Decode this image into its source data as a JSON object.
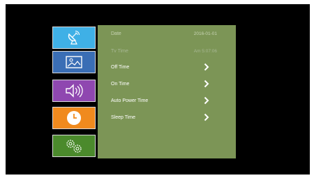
{
  "sidebar": {
    "tabs": [
      {
        "icon": "satellite-dish-icon",
        "color": "#3fb0e6"
      },
      {
        "icon": "picture-icon",
        "color": "#3a6eb5"
      },
      {
        "icon": "speaker-icon",
        "color": "#8f47b0"
      },
      {
        "icon": "clock-icon",
        "color": "#f08a1e",
        "selected": true
      },
      {
        "icon": "gears-icon",
        "color": "#4b8a2c"
      }
    ]
  },
  "menu": {
    "date_label": "Date",
    "date_value": "2016-01-01",
    "tvtime_label": "Tv Time",
    "tvtime_value": "Am 5:07:06",
    "items": [
      {
        "label": "Off Time"
      },
      {
        "label": "On Time"
      },
      {
        "label": "Auto Power Time"
      },
      {
        "label": "Sleep Time"
      }
    ]
  },
  "colors": {
    "panel": "#7c9556",
    "screen": "#000000"
  }
}
